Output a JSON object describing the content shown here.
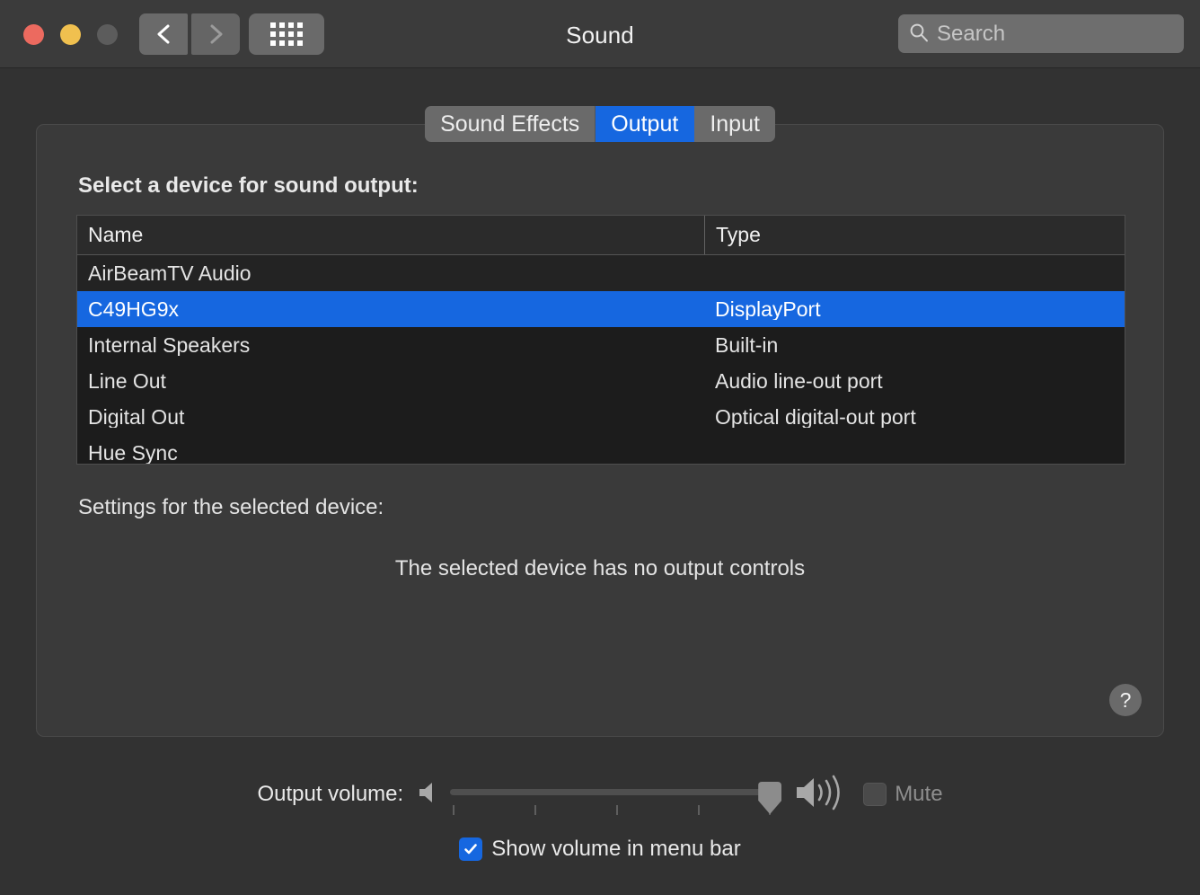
{
  "window": {
    "title": "Sound",
    "traffic_lights": [
      "close",
      "minimize",
      "zoom"
    ]
  },
  "toolbar": {
    "back_icon": "chevron-left-icon",
    "forward_icon": "chevron-right-icon",
    "show_all_icon": "grid-icon",
    "search": {
      "icon": "search-icon",
      "placeholder": "Search",
      "value": ""
    }
  },
  "tabs": [
    {
      "label": "Sound Effects",
      "selected": false
    },
    {
      "label": "Output",
      "selected": true
    },
    {
      "label": "Input",
      "selected": false
    }
  ],
  "panel": {
    "select_label": "Select a device for sound output:",
    "settings_label": "Settings for the selected device:",
    "no_controls_message": "The selected device has no output controls",
    "help_label": "?"
  },
  "device_table": {
    "columns": [
      "Name",
      "Type"
    ],
    "rows": [
      {
        "name": "AirBeamTV Audio",
        "type": "",
        "selected": false
      },
      {
        "name": "C49HG9x",
        "type": "DisplayPort",
        "selected": true
      },
      {
        "name": "Internal Speakers",
        "type": "Built-in",
        "selected": false
      },
      {
        "name": "Line Out",
        "type": "Audio line-out port",
        "selected": false
      },
      {
        "name": "Digital Out",
        "type": "Optical digital-out port",
        "selected": false
      },
      {
        "name": "Hue Sync",
        "type": "",
        "selected": false
      }
    ]
  },
  "volume": {
    "label": "Output volume:",
    "low_icon": "speaker-low-icon",
    "high_icon": "speaker-high-icon",
    "value_percent": 96,
    "tick_count": 5,
    "mute": {
      "label": "Mute",
      "checked": false,
      "enabled": false
    }
  },
  "menubar_option": {
    "label": "Show volume in menu bar",
    "checked": true
  },
  "colors": {
    "accent": "#1667e0",
    "window_bg": "#323232",
    "titlebar_bg": "#3b3b3b",
    "panel_bg": "#3a3a3a",
    "table_bg": "#1c1c1c",
    "text": "#e9e9e9",
    "disabled_text": "#8e8e8e",
    "close_light": "#ec6a5f",
    "min_light": "#f0c04f",
    "zoom_light": "#5c5c5c"
  }
}
